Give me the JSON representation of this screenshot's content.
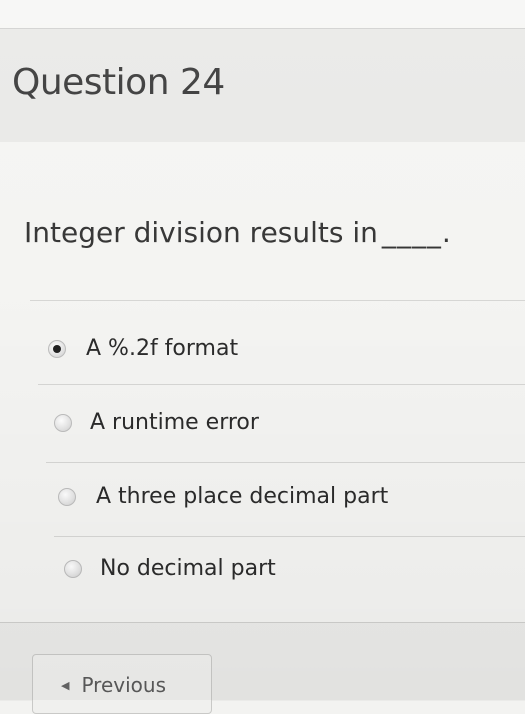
{
  "question": {
    "title": "Question 24",
    "text": "Integer division results in",
    "blank": "____."
  },
  "answers": [
    {
      "label": "A %.2f format",
      "selected": true
    },
    {
      "label": "A runtime error",
      "selected": false
    },
    {
      "label": "A three place decimal part",
      "selected": false
    },
    {
      "label": "No decimal part",
      "selected": false
    }
  ],
  "navigation": {
    "previous_label": "Previous",
    "previous_icon": "left-arrow-icon"
  }
}
